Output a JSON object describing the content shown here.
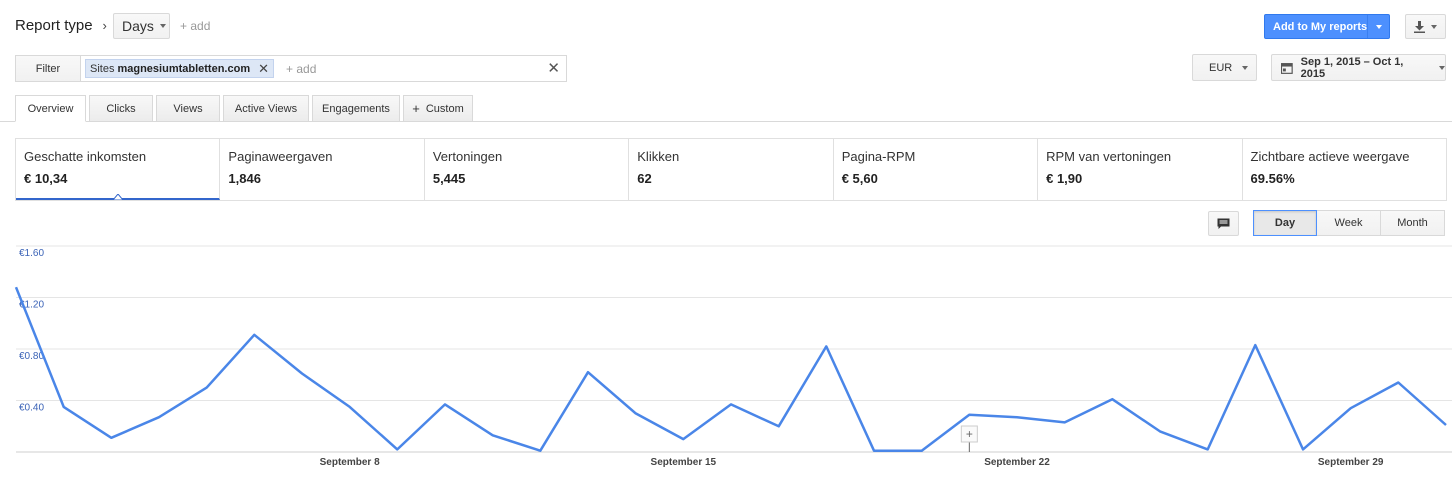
{
  "header": {
    "report_type_label": "Report type",
    "dimension_label": "Days",
    "add_label": "+ add",
    "add_to_reports_label": "Add to My reports"
  },
  "filter": {
    "label": "Filter",
    "chip_key": "Sites",
    "chip_value": "magnesiumtabletten.com",
    "add_label": "+ add"
  },
  "currency": "EUR",
  "date_range": "Sep 1, 2015 – Oct 1, 2015",
  "tabs": [
    {
      "label": "Overview"
    },
    {
      "label": "Clicks"
    },
    {
      "label": "Views"
    },
    {
      "label": "Active Views"
    },
    {
      "label": "Engagements"
    },
    {
      "label": "Custom"
    }
  ],
  "metrics": [
    {
      "label": "Geschatte inkomsten",
      "value": "€ 10,34"
    },
    {
      "label": "Paginaweergaven",
      "value": "1,846"
    },
    {
      "label": "Vertoningen",
      "value": "5,445"
    },
    {
      "label": "Klikken",
      "value": "62"
    },
    {
      "label": "Pagina-RPM",
      "value": "€ 5,60"
    },
    {
      "label": "RPM van vertoningen",
      "value": "€ 1,90"
    },
    {
      "label": "Zichtbare actieve weergave",
      "value": "69.56%"
    }
  ],
  "granularity": [
    {
      "label": "Day"
    },
    {
      "label": "Week"
    },
    {
      "label": "Month"
    }
  ],
  "colors": {
    "accent": "#4d90fe",
    "line": "#4a86e8",
    "y_label": "#3b63b7"
  },
  "chart_data": {
    "type": "line",
    "ylim": [
      0,
      1.6
    ],
    "y_ticks": [
      "€1.60",
      "€1.20",
      "€0.80",
      "€0.40"
    ],
    "x_tick_labels": [
      {
        "label": "September 8",
        "day": 8
      },
      {
        "label": "September 15",
        "day": 15
      },
      {
        "label": "September 22",
        "day": 22
      },
      {
        "label": "September 29",
        "day": 29
      }
    ],
    "series": [
      {
        "x": [
          1,
          2,
          3,
          4,
          5,
          6,
          7,
          8,
          9,
          10,
          11,
          12,
          13,
          14,
          15,
          16,
          17,
          18,
          19,
          20,
          21,
          22,
          23,
          24,
          25,
          26,
          27,
          28,
          29,
          30,
          31
        ],
        "values": [
          1.28,
          0.35,
          0.11,
          0.27,
          0.5,
          0.91,
          0.61,
          0.35,
          0.02,
          0.37,
          0.13,
          0.01,
          0.62,
          0.3,
          0.1,
          0.37,
          0.2,
          0.82,
          0.01,
          0.01,
          0.29,
          0.27,
          0.23,
          0.41,
          0.16,
          0.02,
          0.83,
          0.02,
          0.34,
          0.54,
          0.21
        ]
      }
    ]
  }
}
